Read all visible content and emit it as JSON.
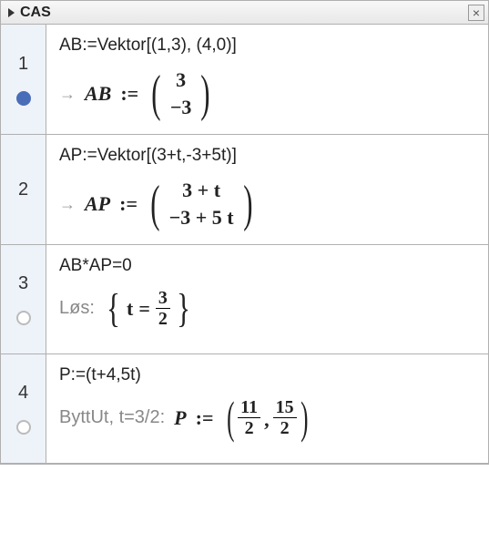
{
  "header": {
    "title": "CAS",
    "close_glyph": "×"
  },
  "rows": [
    {
      "num": "1",
      "marker": "filled",
      "input": "AB:=Vektor[(1,3), (4,0)]",
      "out_var": "AB",
      "assign": ":=",
      "vec": {
        "r1": "3",
        "r2": "−3"
      }
    },
    {
      "num": "2",
      "marker": "none",
      "input": "AP:=Vektor[(3+t,-3+5t)]",
      "out_var": "AP",
      "assign": ":=",
      "vec": {
        "r1": "3 + t",
        "r2": "−3 + 5 t"
      }
    },
    {
      "num": "3",
      "marker": "empty",
      "input": "AB*AP=0",
      "prefix": "Løs:",
      "eq_lhs": "t",
      "eq_op": "=",
      "frac": {
        "num": "3",
        "den": "2"
      }
    },
    {
      "num": "4",
      "marker": "empty",
      "input": "P:=(t+4,5t)",
      "prefix": "ByttUt, t=3/2:",
      "out_var": "P",
      "assign": ":=",
      "tuple": {
        "a": {
          "num": "11",
          "den": "2"
        },
        "b": {
          "num": "15",
          "den": "2"
        }
      }
    }
  ]
}
